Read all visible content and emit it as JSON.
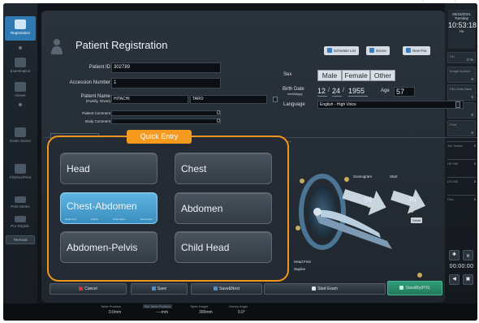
{
  "left_rail": {
    "items": [
      {
        "label": "Registration",
        "active": true
      },
      {
        "label": "Examination",
        "active": false
      },
      {
        "label": "Viewer",
        "active": false
      },
      {
        "label": "Exam Series",
        "active": false
      },
      {
        "label": "Filmbox/Print",
        "active": false
      },
      {
        "label": "Print Series",
        "active": false
      },
      {
        "label": "Pre Registr.",
        "active": false
      }
    ],
    "btn_terminal": "Terminal",
    "menu_label": "MenuBtn"
  },
  "right_rail": {
    "date": "06/15/2021",
    "day": "Tuesday",
    "time": "10:53:18",
    "hu": "Hu",
    "items": [
      {
        "label": "HU",
        "value": "0 %"
      },
      {
        "label": "Image Archive",
        "value": "0"
      },
      {
        "label": "Film Data Base",
        "value": "0"
      },
      {
        "label": "Queue",
        "value": "0"
      },
      {
        "label": "Print",
        "value": "0"
      },
      {
        "label": "Job Status",
        "value": "0"
      },
      {
        "label": "HD Net",
        "value": "0"
      },
      {
        "label": "DICOM",
        "value": "0"
      },
      {
        "label": "Disc",
        "value": "0"
      }
    ],
    "timer": "00:00:00"
  },
  "header": {
    "title": "Patient Registration",
    "buttons": [
      {
        "label": "Schedule List",
        "icon": "list-icon"
      },
      {
        "label": "Scene",
        "icon": "scene-icon"
      },
      {
        "label": "New Pat.",
        "icon": "new-patient-icon"
      }
    ]
  },
  "form": {
    "patient_id_label": "Patient ID",
    "patient_id": "302789",
    "accession_label": "Accession Number",
    "accession": "1",
    "patient_name_label": "Patient Name",
    "patient_name_sub": "(Family, Given)",
    "family_name": "HITACHI",
    "given_name": "TARO",
    "patient_comment_label": "Patient Comment",
    "body_comment_label": "Body Comment",
    "sex_label": "Sex",
    "sex_options": [
      "Male",
      "Female",
      "Other"
    ],
    "birth_label": "Birth Date",
    "birth_format": "mm/dd/yyyy",
    "birth_month": "12",
    "birth_day": "24",
    "birth_year": "1955",
    "age_label": "Age",
    "age": "57",
    "language_label": "Language",
    "language": "English - High Voice"
  },
  "quick_entry": {
    "title": "Quick Entry",
    "tiles": [
      {
        "label": "Head",
        "selected": false
      },
      {
        "label": "Chest",
        "selected": false
      },
      {
        "label": "Chest-Abdomen",
        "selected": true,
        "sub": [
          "Head First",
          "Supine",
          "Scanogram",
          "Scanogram"
        ]
      },
      {
        "label": "Abdomen",
        "selected": false
      },
      {
        "label": "Abdomen-Pelvis",
        "selected": false
      },
      {
        "label": "Child Head",
        "selected": false
      }
    ]
  },
  "position": {
    "scanogram_label": "Scanogram",
    "start_label": "Start",
    "in_label": "IN",
    "detail_label": "Detail",
    "orientation": "Head First",
    "posture": "Supine"
  },
  "actions": {
    "cancel": "Cancel",
    "save": "Save",
    "save_next": "Save&Next",
    "start_exam": "Start Exam",
    "standby": "StandBy(P/S)"
  },
  "status_bar": {
    "table_position_label": "Table Position",
    "table_position": "0.0mm",
    "rel_table_label": "Rel Table Position",
    "rel_table": "----mm",
    "table_height_label": "Table Height",
    "table_height": "300mm",
    "gantry_angle_label": "Gantry Angle",
    "gantry_angle": "0.0°"
  },
  "colors": {
    "accent_orange": "#f39a1f",
    "selected_blue": "#3a8fc0",
    "active_rail": "#2f79b2",
    "go_green": "#2f9b76"
  }
}
